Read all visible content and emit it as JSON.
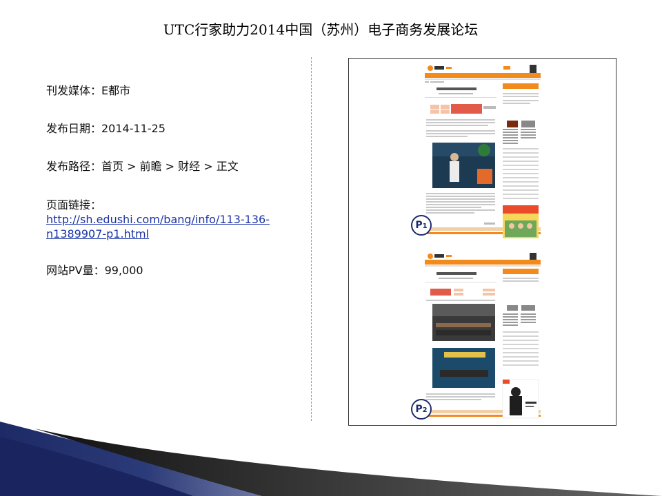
{
  "slide": {
    "title": "UTC行家助力2014中国（苏州）电子商务发展论坛"
  },
  "info": {
    "media_label": "刊发媒体：E都市",
    "date_label": "发布日期：2014-11-25",
    "path_label": "发布路径：首页 > 前瞻 > 财经 > 正文",
    "link_label": "页面链接：",
    "link_line1": "http://sh.edushi.com/bang/info/113-136-",
    "link_line2": "n1389907-p1.html",
    "pv_label": "网站PV量：99,000"
  },
  "screenshot": {
    "p1_letter": "P",
    "p1_num": "1",
    "p2_letter": "P",
    "p2_num": "2"
  },
  "colors": {
    "accent": "#f28a1c",
    "badge": "#1e2b6b",
    "link": "#1a33a6",
    "swoosh": "#1c2a66"
  }
}
